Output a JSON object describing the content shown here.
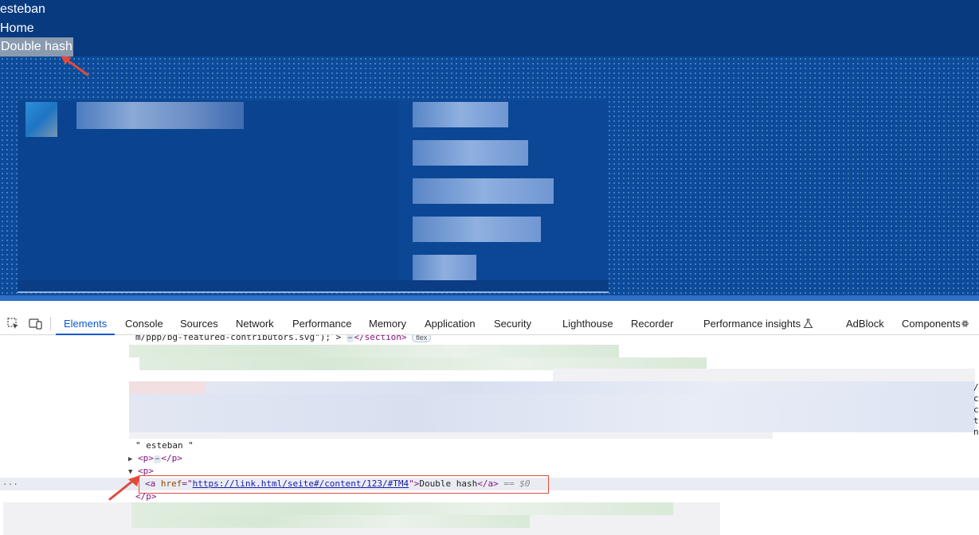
{
  "page": {
    "nav": {
      "name": "esteban",
      "home": "Home",
      "double_hash": "Double hash"
    }
  },
  "devtools": {
    "tabs": [
      "Elements",
      "Console",
      "Sources",
      "Network",
      "Performance",
      "Memory",
      "Application",
      "Security",
      "Lighthouse",
      "Recorder",
      "Performance insights",
      "AdBlock",
      "Components"
    ],
    "active_tab": "Elements",
    "icons": {
      "inspect": "inspect-element-icon",
      "device": "device-toolbar-icon",
      "insights": "flask-icon",
      "components": "react-components-icon"
    },
    "elements": {
      "line0_text": "m/ppp/bg-featured-contributors.svg\"); >",
      "line0_tag": "</section>",
      "flex_badge": "flex",
      "text_node": "\" esteban \"",
      "p_open": "<p>",
      "p_close": "</p>",
      "ellipsis": "⋯",
      "a_open": "<a ",
      "a_attr": "href",
      "a_eq": "=\"",
      "a_href": "https://link.html/seite#/content/123/#TM4",
      "a_quote_close": "\">",
      "a_text": "Double hash",
      "a_close": "</a>",
      "selected_marker": "== $0",
      "row_dots": "..."
    },
    "right_edge_chars": [
      "/",
      "c",
      "c",
      "t",
      "n"
    ]
  },
  "colors": {
    "page_bg": "#083a80",
    "highlight": "#8a9bb0",
    "accent": "#0b57d0",
    "annotation": "#e04a3a"
  }
}
